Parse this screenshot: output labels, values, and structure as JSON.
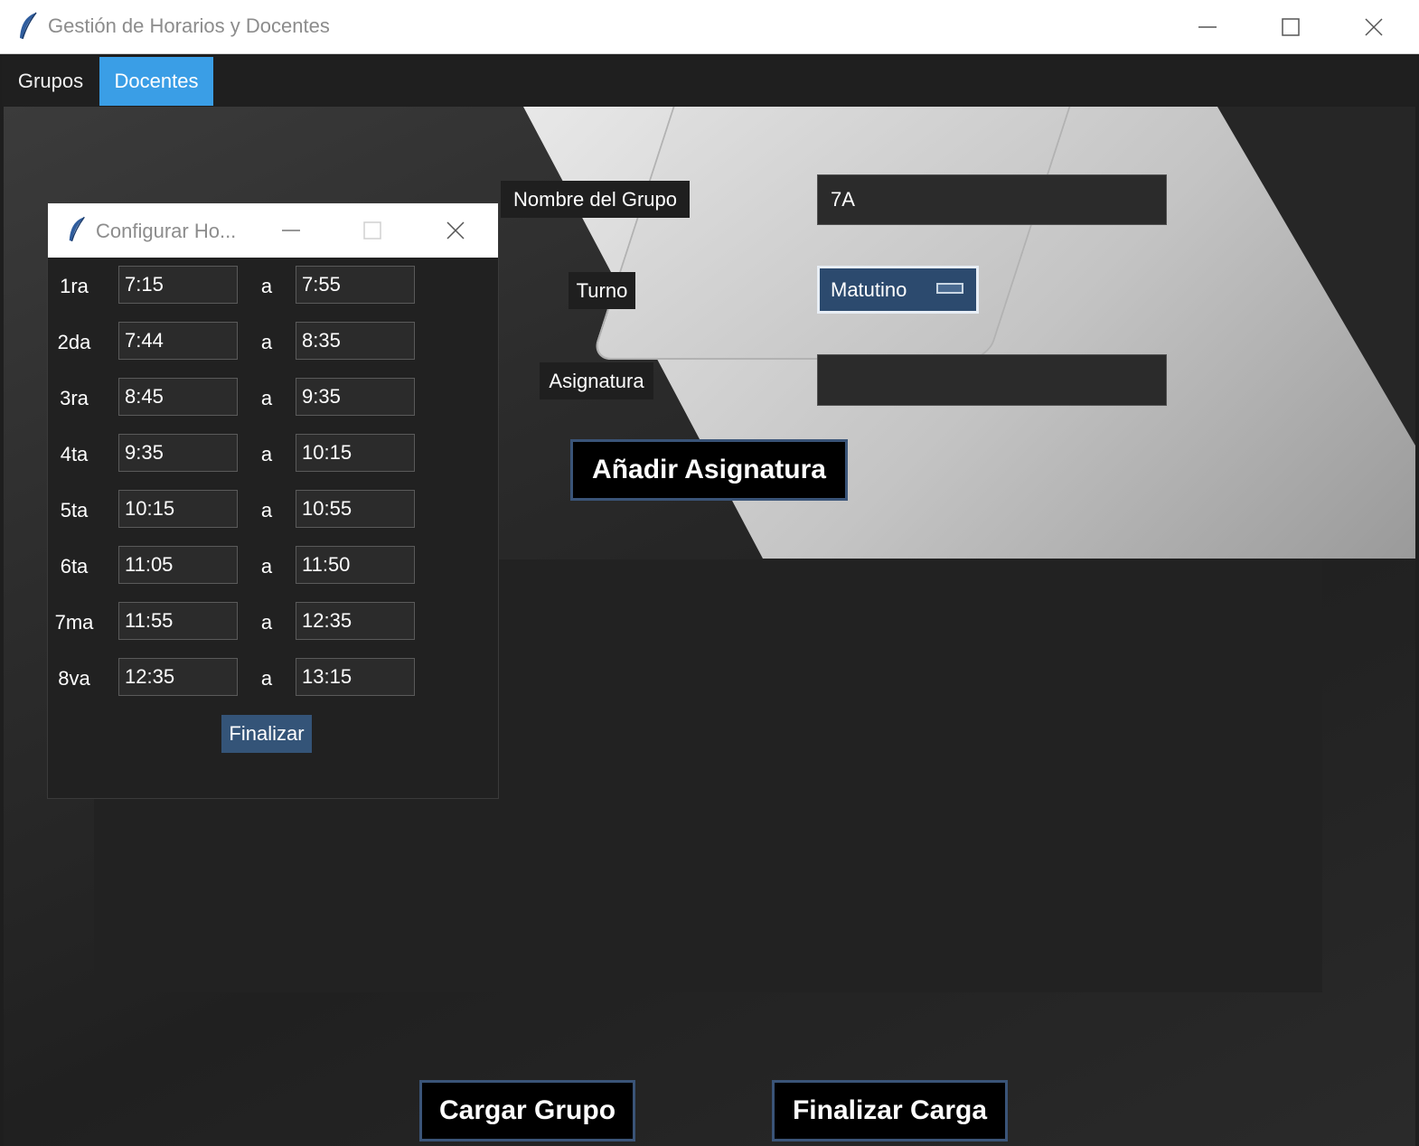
{
  "window": {
    "title": "Gestión de Horarios y Docentes",
    "icon": "feather-icon"
  },
  "menu": {
    "tabs": [
      {
        "label": "Grupos",
        "active": false
      },
      {
        "label": "Docentes",
        "active": true
      }
    ]
  },
  "form": {
    "group_name_label": "Nombre del Grupo",
    "group_name_value": "7A",
    "turno_label": "Turno",
    "turno_value": "Matutino",
    "asignatura_label": "Asignatura",
    "asignatura_value": "",
    "add_subject_button": "Añadir Asignatura"
  },
  "actions": {
    "load_group_button": "Cargar Grupo",
    "finish_load_button": "Finalizar Carga"
  },
  "dialog": {
    "title": "Configurar Ho...",
    "separator": "a",
    "periods": [
      {
        "label": "1ra",
        "start": "7:15",
        "end": "7:55"
      },
      {
        "label": "2da",
        "start": "7:44",
        "end": "8:35"
      },
      {
        "label": "3ra",
        "start": "8:45",
        "end": "9:35"
      },
      {
        "label": "4ta",
        "start": "9:35",
        "end": "10:15"
      },
      {
        "label": "5ta",
        "start": "10:15",
        "end": "10:55"
      },
      {
        "label": "6ta",
        "start": "11:05",
        "end": "11:50"
      },
      {
        "label": "7ma",
        "start": "11:55",
        "end": "12:35"
      },
      {
        "label": "8va",
        "start": "12:35",
        "end": "13:15"
      }
    ],
    "finish_button": "Finalizar"
  },
  "colors": {
    "active_tab": "#3a9ee6",
    "combo_bg": "#2c4a6e",
    "button_border": "#3a5478",
    "panel_bg": "#212121"
  }
}
